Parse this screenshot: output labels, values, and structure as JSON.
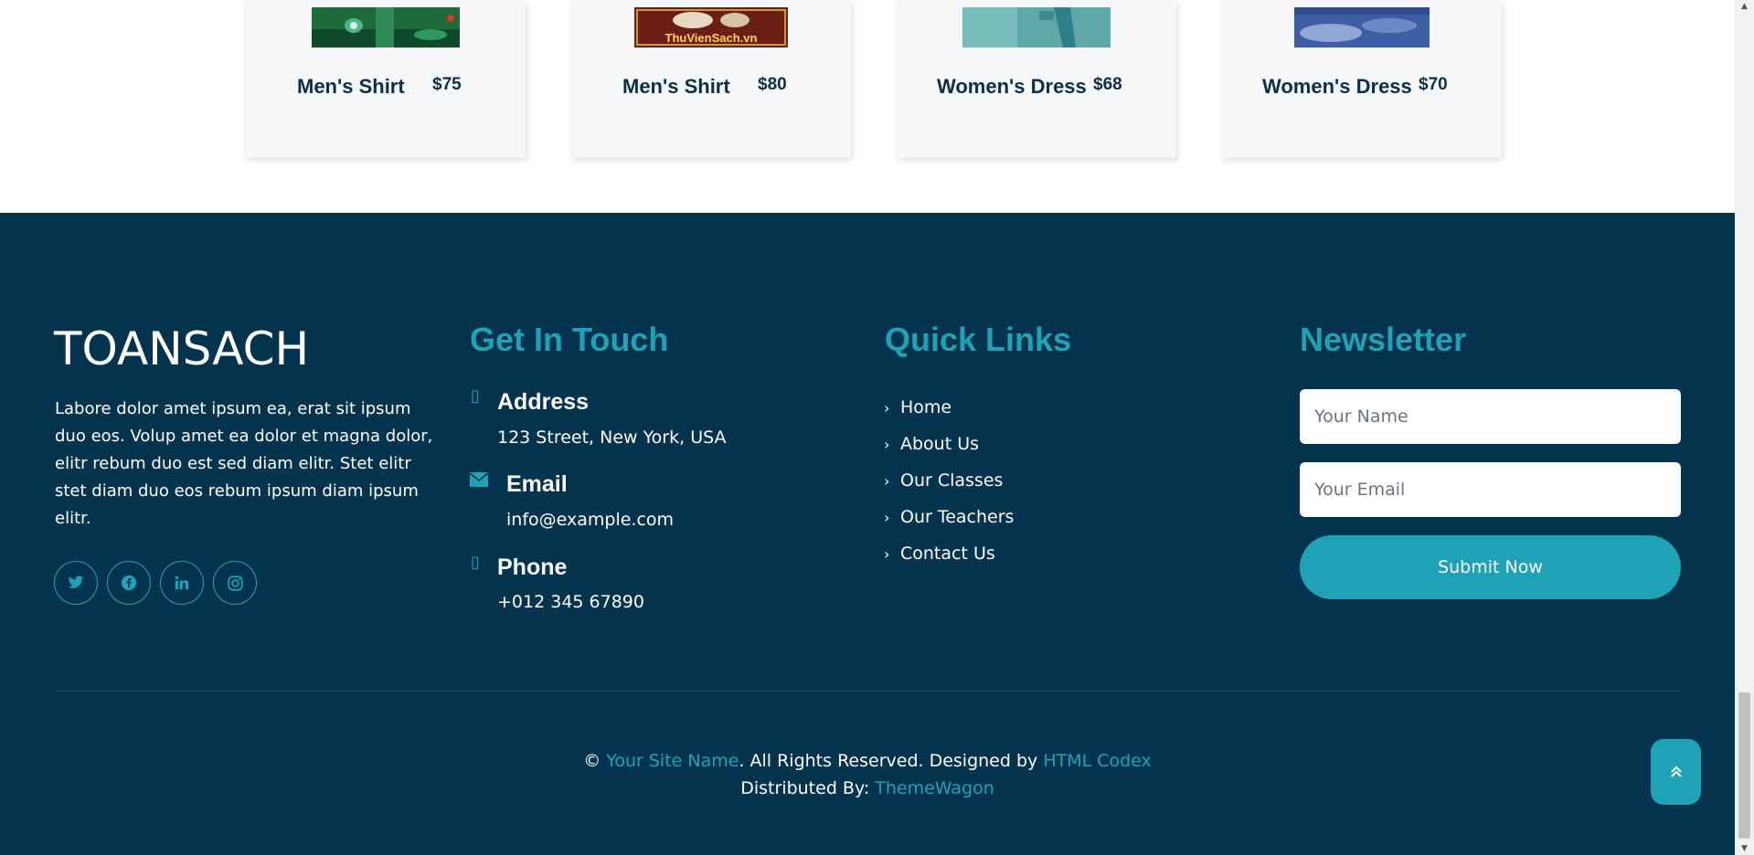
{
  "products": [
    {
      "name": "Men's Shirt",
      "price": "$75",
      "image": "product-image-green"
    },
    {
      "name": "Men's Shirt",
      "price": "$80",
      "image": "product-image-book",
      "image_text": "ThuVienSach.vn"
    },
    {
      "name": "Women's Dress",
      "price": "$68",
      "image": "product-image-teal"
    },
    {
      "name": "Women's Dress",
      "price": "$70",
      "image": "product-image-blue"
    }
  ],
  "footer": {
    "brand": "TOANSACH",
    "about": "Labore dolor amet ipsum ea, erat sit ipsum duo eos. Volup amet ea dolor et magna dolor, elitr rebum duo est sed diam elitr. Stet elitr stet diam duo eos rebum ipsum diam ipsum elitr.",
    "socials": [
      {
        "name": "twitter-icon",
        "glyph": "𝕏"
      },
      {
        "name": "facebook-icon",
        "glyph": "f"
      },
      {
        "name": "linkedin-icon",
        "glyph": "in"
      },
      {
        "name": "instagram-icon",
        "glyph": "◎"
      }
    ],
    "contact": {
      "title": "Get In Touch",
      "address_label": "Address",
      "address": "123 Street, New York, USA",
      "email_label": "Email",
      "email": "info@example.com",
      "phone_label": "Phone",
      "phone": "+012 345 67890"
    },
    "quick_links": {
      "title": "Quick Links",
      "items": [
        "Home",
        "About Us",
        "Our Classes",
        "Our Teachers",
        "Contact Us"
      ]
    },
    "newsletter": {
      "title": "Newsletter",
      "name_placeholder": "Your Name",
      "email_placeholder": "Your Email",
      "submit": "Submit Now"
    },
    "copyright": {
      "symbol": "©",
      "site_name": "Your Site Name",
      "rights": ". All Rights Reserved. Designed by ",
      "designer": "HTML Codex",
      "distributed_label": "Distributed By: ",
      "distributor": "ThemeWagon"
    }
  },
  "colors": {
    "footer_bg": "#04344d",
    "accent": "#1fa2b6",
    "card_bg": "#f6f7f8"
  }
}
